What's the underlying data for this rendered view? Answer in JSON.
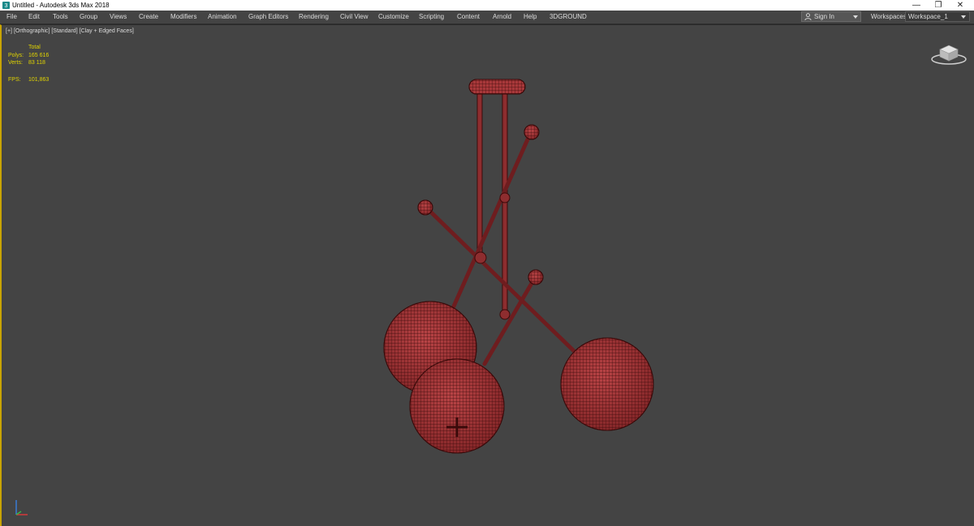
{
  "window": {
    "title": "Untitled - Autodesk 3ds Max 2018",
    "controls": {
      "minimize": "—",
      "restore": "❐",
      "close": "✕"
    }
  },
  "menu": {
    "items": [
      "File",
      "Edit",
      "Tools",
      "Group",
      "Views",
      "Create",
      "Modifiers",
      "Animation",
      "Graph Editors",
      "Rendering",
      "Civil View",
      "Customize",
      "Scripting",
      "Content",
      "Arnold",
      "Help",
      "3DGROUND"
    ]
  },
  "signin": {
    "label": "Sign In"
  },
  "workspaces": {
    "label": "Workspaces:",
    "value": "Workspace_1"
  },
  "viewport": {
    "labels": [
      "[+]",
      "[Orthographic]",
      "[Standard]",
      "[Clay + Edged Faces]"
    ],
    "stats": {
      "total_label": "Total",
      "polys_label": "Polys:",
      "polys_value": "165 616",
      "verts_label": "Verts:",
      "verts_value": "83 118",
      "fps_label": "FPS:",
      "fps_value": "101,863"
    }
  },
  "icons": {
    "app": "3dsmax-app-icon",
    "viewcube": "viewcube-icon",
    "axis": "axis-tripod-icon",
    "user": "user-icon"
  },
  "colors": {
    "viewport_bg": "#444444",
    "stats_text": "#e1d400",
    "active_viewport_border": "#c8a400",
    "wireframe": "#4a0d0d",
    "surface": "#a8383a"
  }
}
